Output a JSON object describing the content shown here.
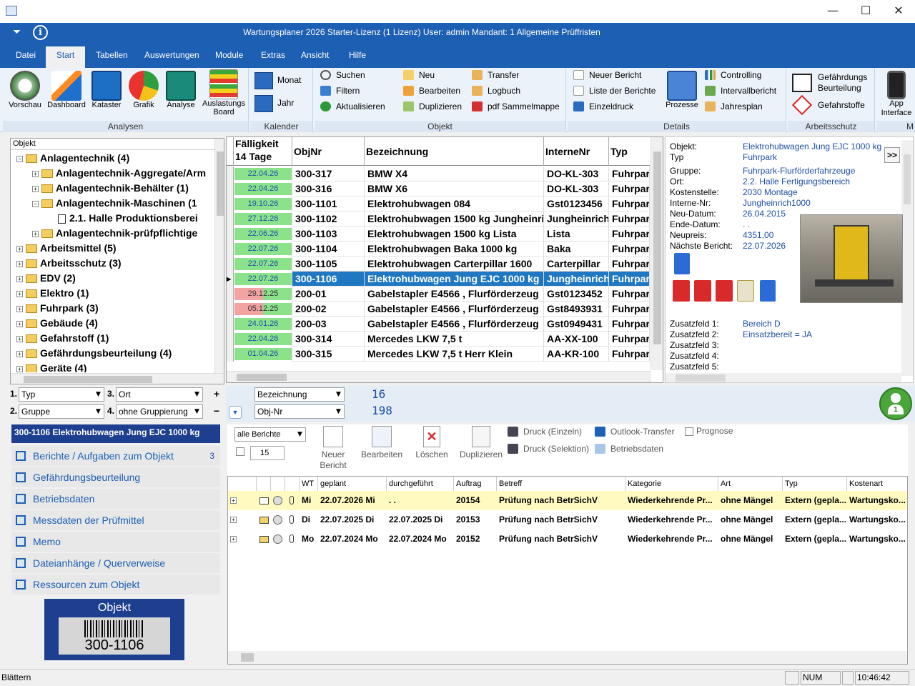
{
  "window": {
    "minimize": "—",
    "maximize": "☐",
    "close": "✕"
  },
  "appbar": {
    "title": "Wartungsplaner 2026 Starter-Lizenz (1 Lizenz)   User: admin   Mandant: 1 Allgemeine Prüffristen",
    "menu_glyph": "⏷",
    "info_glyph": "i"
  },
  "menu": [
    "Datei",
    "Start",
    "Tabellen",
    "Auswertungen",
    "Module",
    "Extras",
    "Ansicht",
    "Hilfe"
  ],
  "ribbon": {
    "analysen": {
      "label": "Analysen",
      "buttons": [
        "Vorschau",
        "Dashboard",
        "Kataster",
        "Grafik",
        "Analyse",
        "Auslastungs Board"
      ]
    },
    "kalender": {
      "label": "Kalender",
      "buttons": [
        "Monat",
        "Jahr"
      ]
    },
    "objekt": {
      "label": "Objekt",
      "col1": [
        "Suchen",
        "Filtern",
        "Aktualisieren"
      ],
      "col2": [
        "Neu",
        "Bearbeiten",
        "Duplizieren"
      ],
      "col3": [
        "Transfer",
        "Logbuch",
        "pdf Sammelmappe"
      ]
    },
    "details": {
      "label": "Details",
      "col1": [
        "Neuer Bericht",
        "Liste der Berichte",
        "Einzeldruck"
      ],
      "prozesse": "Prozesse",
      "col2": [
        "Controlling",
        "Intervallbericht",
        "Jahresplan"
      ]
    },
    "arbeitsschutz": {
      "label": "Arbeitsschutz",
      "gb": "Gefährdungs Beurteilung",
      "gs": "Gefahrstoffe"
    },
    "app": {
      "label": "App Interface",
      "cut": "M"
    }
  },
  "tree": {
    "header": "Objekt",
    "items": [
      {
        "label": "Anlagentechnik  (4)",
        "level": 0,
        "exp": "−"
      },
      {
        "label": "Anlagentechnik-Aggregate/Arm",
        "level": 1,
        "exp": "+"
      },
      {
        "label": "Anlagentechnik-Behälter  (1)",
        "level": 1,
        "exp": "+"
      },
      {
        "label": "Anlagentechnik-Maschinen  (1",
        "level": 1,
        "exp": "−"
      },
      {
        "label": "2.1. Halle Produktionsberei",
        "level": 2,
        "exp": ""
      },
      {
        "label": "Anlagentechnik-prüfpflichtige",
        "level": 1,
        "exp": "+"
      },
      {
        "label": "Arbeitsmittel  (5)",
        "level": 0,
        "exp": "+"
      },
      {
        "label": "Arbeitsschutz  (3)",
        "level": 0,
        "exp": "+"
      },
      {
        "label": "EDV  (2)",
        "level": 0,
        "exp": "+"
      },
      {
        "label": "Elektro  (1)",
        "level": 0,
        "exp": "+"
      },
      {
        "label": "Fuhrpark  (3)",
        "level": 0,
        "exp": "+"
      },
      {
        "label": "Gebäude  (4)",
        "level": 0,
        "exp": "+"
      },
      {
        "label": "Gefahrstoff  (1)",
        "level": 0,
        "exp": "+"
      },
      {
        "label": "Gefährdungsbeurteilung  (4)",
        "level": 0,
        "exp": "+"
      },
      {
        "label": "Geräte  (4)",
        "level": 0,
        "exp": "+"
      }
    ]
  },
  "grid": {
    "headers": [
      "Fälligkeit 14 Tage",
      "ObjNr",
      "Bezeichnung",
      "InterneNr",
      "Typ"
    ],
    "rows": [
      {
        "date": "22.04.26",
        "status": "green",
        "objnr": "300-317",
        "bez": "BMW X4",
        "inr": "DO-KL-303",
        "typ": "Fuhrpark"
      },
      {
        "date": "22.04.26",
        "status": "green",
        "objnr": "300-316",
        "bez": "BMW X6",
        "inr": "DO-KL-303",
        "typ": "Fuhrpark"
      },
      {
        "date": "19.10.26",
        "status": "green",
        "objnr": "300-1101",
        "bez": "Elektrohubwagen 084",
        "inr": "Gst0123456",
        "typ": "Fuhrpark"
      },
      {
        "date": "27.12.26",
        "status": "green",
        "objnr": "300-1102",
        "bez": "Elektrohubwagen 1500 kg  Jungheinrich",
        "inr": "Jungheinrich",
        "typ": "Fuhrpark"
      },
      {
        "date": "22.06.26",
        "status": "green",
        "objnr": "300-1103",
        "bez": "Elektrohubwagen 1500 kg Lista",
        "inr": "Lista",
        "typ": "Fuhrpark"
      },
      {
        "date": "22.07.26",
        "status": "green",
        "objnr": "300-1104",
        "bez": "Elektrohubwagen Baka 1000 kg",
        "inr": "Baka",
        "typ": "Fuhrpark"
      },
      {
        "date": "22.07.26",
        "status": "green",
        "objnr": "300-1105",
        "bez": "Elektrohubwagen Carterpillar 1600",
        "inr": "Carterpillar",
        "typ": "Fuhrpark"
      },
      {
        "date": "22.07.26",
        "status": "green",
        "objnr": "300-1106",
        "bez": "Elektrohubwagen Jung EJC 1000 kg",
        "inr": "Jungheinrich",
        "typ": "Fuhrpark",
        "selected": true
      },
      {
        "date": "29.12.25",
        "status": "red",
        "objnr": "200-01",
        "bez": "Gabelstapler E4566 , Flurförderzeug",
        "inr": "Gst0123452",
        "typ": "Fuhrpark"
      },
      {
        "date": "05.12.25",
        "status": "red",
        "objnr": "200-02",
        "bez": "Gabelstapler E4566 , Flurförderzeug",
        "inr": "Gst8493931",
        "typ": "Fuhrpark"
      },
      {
        "date": "24.01.26",
        "status": "green",
        "objnr": "200-03",
        "bez": "Gabelstapler E4566 , Flurförderzeug",
        "inr": "Gst0949431",
        "typ": "Fuhrpark"
      },
      {
        "date": "22.04.26",
        "status": "green",
        "objnr": "300-314",
        "bez": "Mercedes LKW 7,5 t",
        "inr": "AA-XX-100",
        "typ": "Fuhrpark"
      },
      {
        "date": "01.04.26",
        "status": "green",
        "objnr": "300-315",
        "bez": "Mercedes LKW 7,5 t Herr Klein",
        "inr": "AA-KR-100",
        "typ": "Fuhrpark"
      }
    ]
  },
  "details": {
    "nav": ">>",
    "fields": [
      {
        "label": "Objekt:",
        "value": "Elektrohubwagen Jung EJC 1000 kg"
      },
      {
        "label": "Typ",
        "value": "Fuhrpark"
      },
      {
        "label": "Gruppe:",
        "value": "Fuhrpark-Flurförderfahrzeuge"
      },
      {
        "label": "Ort:",
        "value": "2.2. Halle Fertigungsbereich"
      },
      {
        "label": "Kostenstelle:",
        "value": "2030 Montage"
      },
      {
        "label": "Interne-Nr:",
        "value": "Jungheinrich1000"
      },
      {
        "label": "Neu-Datum:",
        "value": "26.04.2015"
      },
      {
        "label": "Ende-Datum:",
        "value": ". ."
      },
      {
        "label": "Neupreis:",
        "value": "4351,00"
      },
      {
        "label": "Nächste Bericht:",
        "value": "22.07.2026"
      }
    ],
    "zusatz": [
      {
        "label": "Zusatzfeld 1:",
        "value": "Bereich D"
      },
      {
        "label": "Zusatzfeld 2:",
        "value": "Einsatzbereit = JA"
      },
      {
        "label": "Zusatzfeld 3:",
        "value": ""
      },
      {
        "label": "Zusatzfeld 4:",
        "value": ""
      },
      {
        "label": "Zusatzfeld 5:",
        "value": ""
      }
    ]
  },
  "filters": {
    "f1_num": "1.",
    "f1": "Typ",
    "f2_num": "2.",
    "f2": "Gruppe",
    "f3_num": "3.",
    "f3": "Ort",
    "f4_num": "4.",
    "f4": "ohne Gruppierung",
    "sort1": "Bezeichnung",
    "sort2": "Obj-Nr",
    "count1": "16",
    "count2": "198",
    "plus": "+",
    "minus": "−",
    "user_badge": "1"
  },
  "left_nav": {
    "title": "300-1106 Elektrohubwagen Jung EJC 1000 kg",
    "items": [
      {
        "label": "Berichte / Aufgaben zum Objekt",
        "count": "3"
      },
      {
        "label": "Gefährdungsbeurteilung",
        "count": ""
      },
      {
        "label": "Betriebsdaten",
        "count": ""
      },
      {
        "label": "Messdaten der Prüfmittel",
        "count": ""
      },
      {
        "label": "Memo",
        "count": ""
      },
      {
        "label": "Dateianhänge / Querverweise",
        "count": ""
      },
      {
        "label": "Ressourcen zum Objekt",
        "count": ""
      }
    ],
    "barcode_title": "Objekt",
    "barcode_value": "300-1106"
  },
  "reports": {
    "filter": "alle Berichte",
    "count": "15",
    "buttons": [
      "Neuer Bericht",
      "Bearbeiten",
      "Löschen",
      "Duplizieren"
    ],
    "print_single": "Druck (Einzeln)",
    "print_sel": "Druck (Selektion)",
    "outlook": "Outlook-Transfer",
    "betriebsdaten": "Betriebsdaten",
    "prognose": "Prognose",
    "headers": [
      "WT",
      "geplant",
      "durchgeführt",
      "Auftrag",
      "Betreff",
      "Kategorie",
      "Art",
      "Typ",
      "Kostenart"
    ],
    "rows": [
      {
        "wt": "Mi",
        "geplant": "22.07.2026 Mi",
        "durch": ". .",
        "auftrag": "20154",
        "betreff": "Prüfung nach BetrSichV",
        "kat": "Wiederkehrende Pr...",
        "art": "ohne Mängel",
        "typ": "Extern (gepla...",
        "kost": "Wartungsko...",
        "highlight": true
      },
      {
        "wt": "Di",
        "geplant": "22.07.2025 Di",
        "durch": "22.07.2025 Di",
        "auftrag": "20153",
        "betreff": "Prüfung nach BetrSichV",
        "kat": "Wiederkehrende Pr...",
        "art": "ohne Mängel",
        "typ": "Extern (gepla...",
        "kost": "Wartungsko..."
      },
      {
        "wt": "Mo",
        "geplant": "22.07.2024 Mo",
        "durch": "22.07.2024 Mo",
        "auftrag": "20152",
        "betreff": "Prüfung nach BetrSichV",
        "kat": "Wiederkehrende Pr...",
        "art": "ohne Mängel",
        "typ": "Extern (gepla...",
        "kost": "Wartungsko..."
      }
    ]
  },
  "statusbar": {
    "left": "Blättern",
    "num": "NUM",
    "time": "10:46:42"
  },
  "colors": {
    "blue": "#1d5fb3",
    "green": "#8be28b",
    "red": "#f4a3a3",
    "selected": "#1f78c1",
    "highlight": "#fffbc0"
  }
}
